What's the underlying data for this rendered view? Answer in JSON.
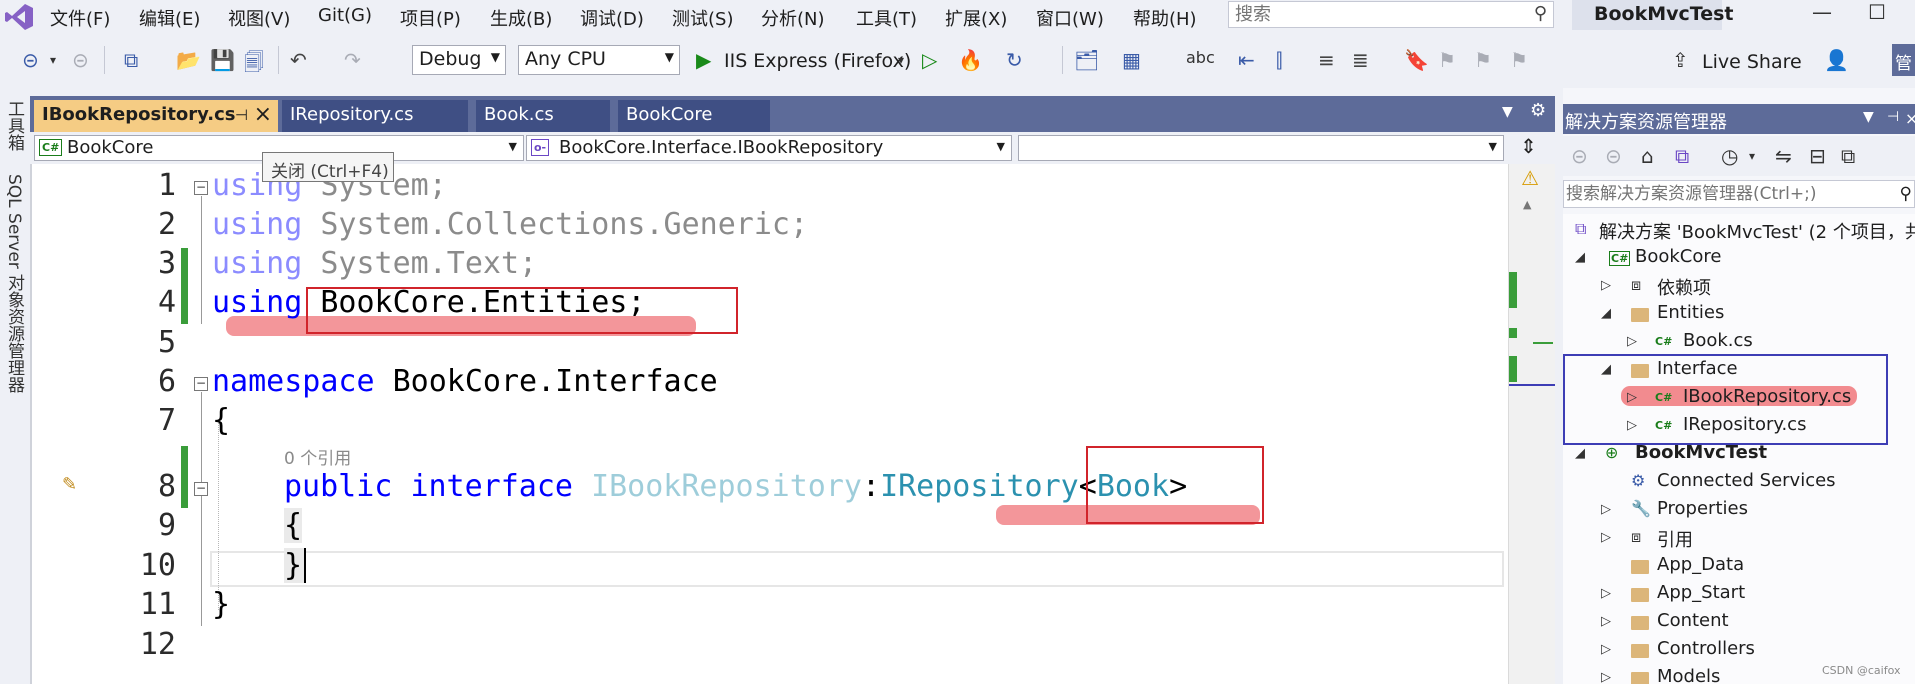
{
  "menu": [
    "文件(F)",
    "编辑(E)",
    "视图(V)",
    "Git(G)",
    "项目(P)",
    "生成(B)",
    "调试(D)",
    "测试(S)",
    "分析(N)",
    "工具(T)",
    "扩展(X)",
    "窗口(W)",
    "帮助(H)"
  ],
  "search": {
    "placeholder": "搜索"
  },
  "app_title": "BookMvcTest",
  "toolbar": {
    "config": "Debug",
    "platform": "Any CPU",
    "run_target": "IIS Express (Firefox)",
    "live_share": "Live Share",
    "cut_label": "管"
  },
  "left_strip": {
    "toolbox": "工具箱",
    "sql_explorer": "SQL Server 对象资源管理器"
  },
  "tabs": [
    {
      "label": "IBookRepository.cs",
      "active": true
    },
    {
      "label": "IRepository.cs"
    },
    {
      "label": "Book.cs"
    },
    {
      "label": "BookCore"
    }
  ],
  "nav": {
    "project": "BookCore",
    "type": "BookCore.Interface.IBookRepository",
    "member": ""
  },
  "tooltip": "关闭 (Ctrl+F4)",
  "code": {
    "line_numbers": [
      "1",
      "2",
      "3",
      "4",
      "5",
      "6",
      "7",
      "8",
      "9",
      "10",
      "11",
      "12"
    ],
    "l1_kw": "using",
    "l1_rest": " System;",
    "l2_kw": "using",
    "l2_rest": " System.Collections.Generic;",
    "l3_kw": "using",
    "l3_rest": " System.Text;",
    "l4_kw": "using",
    "l4_rest": " BookCore.Entities;",
    "l6_kw": "namespace",
    "l6_rest": " BookCore.Interface",
    "l7": "{",
    "codelens": "0 个引用",
    "l8_kw1": "public",
    "l8_kw2": "interface",
    "l8_name": "IBookRepository",
    "l8_colon": ":",
    "l8_base": "IRepository",
    "l8_lt": "<",
    "l8_arg": "Book",
    "l8_gt": ">",
    "l9": "{",
    "l10": "}",
    "l11": "}"
  },
  "solution_explorer": {
    "title": "解决方案资源管理器",
    "search_placeholder": "搜索解决方案资源管理器(Ctrl+;)",
    "tree": [
      {
        "label": "解决方案 'BookMvcTest' (2 个项目，共"
      },
      {
        "label": "BookCore"
      },
      {
        "label": "依赖项"
      },
      {
        "label": "Entities"
      },
      {
        "label": "Book.cs"
      },
      {
        "label": "Interface"
      },
      {
        "label": "IBookRepository.cs"
      },
      {
        "label": "IRepository.cs"
      },
      {
        "label": "BookMvcTest"
      },
      {
        "label": "Connected Services"
      },
      {
        "label": "Properties"
      },
      {
        "label": "引用"
      },
      {
        "label": "App_Data"
      },
      {
        "label": "App_Start"
      },
      {
        "label": "Content"
      },
      {
        "label": "Controllers"
      },
      {
        "label": "Models"
      }
    ]
  },
  "watermark": "CSDN @caifox",
  "colors": {
    "keyword": "#0000ff",
    "type": "#2b91af",
    "tab_active": "#f5cc84",
    "panel_header": "#5d6b99",
    "annotation_red": "#d1242b",
    "annotation_blue": "#3d3db5"
  }
}
